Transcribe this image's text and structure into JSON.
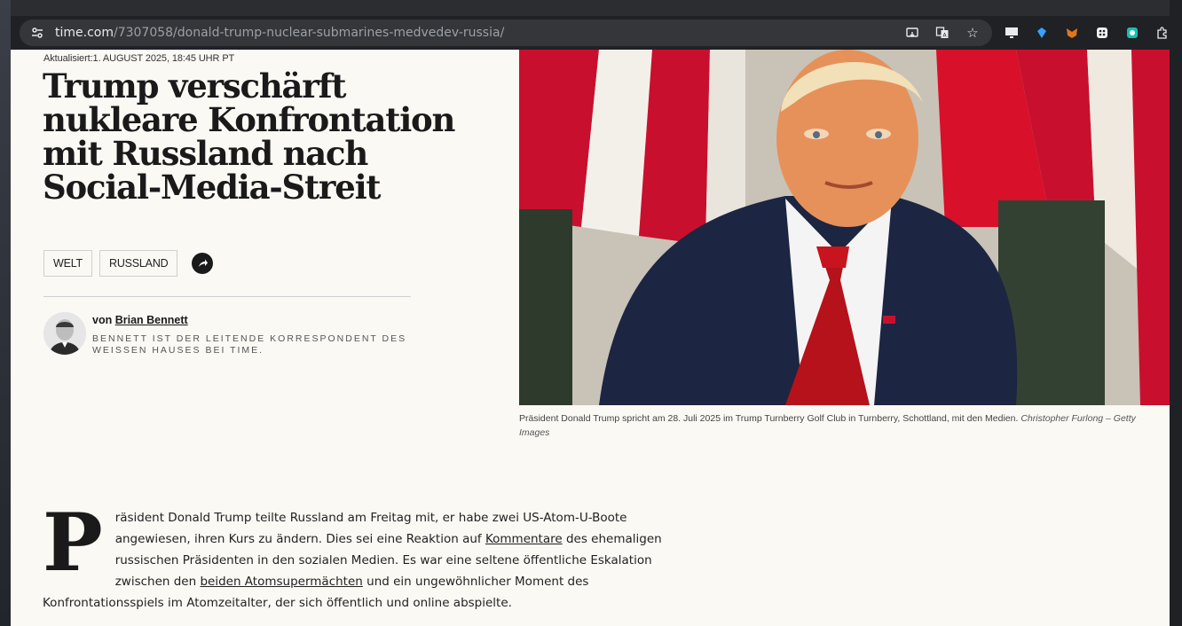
{
  "browser": {
    "url_domain": "time.com",
    "url_path": "/7307058/donald-trump-nuclear-submarines-medvedev-russia/"
  },
  "article": {
    "updated": "Aktualisiert:1. AUGUST 2025, 18:45 UHR PT",
    "headline": "Trump verschärft nukleare Konfrontation mit Russland nach Social-Media-Streit",
    "tags": [
      "WELT",
      "RUSSLAND"
    ],
    "author": {
      "by": "von",
      "name": "Brian Bennett",
      "bio": "Bennett ist der leitende Korrespondent des Weissen Hauses bei TIME."
    },
    "caption": {
      "text": "Präsident Donald Trump spricht am 28. Juli 2025 im Trump Turnberry Golf Club in Turnberry, Schottland, mit den Medien.",
      "credit": "Christopher Furlong – Getty Images"
    },
    "body": {
      "dropcap": "P",
      "part1": "räsident Donald Trump teilte Russland am Freitag mit, er habe zwei US-Atom-U-Boote angewiesen, ihren Kurs zu ändern. Dies sei eine Reaktion auf ",
      "link1": "Kommentare",
      "part2": " des ehemaligen russischen Präsidenten in den sozialen Medien. Es war eine seltene öffentliche Eskalation zwischen den ",
      "link2": "beiden Atomsupermächten",
      "part3": " und ein ungewöhnlicher Moment des Konfrontationsspiels im Atomzeitalter, der sich öffentlich und online abspielte."
    }
  },
  "icons": {
    "site_info": "tune-icon",
    "cast": "cast-icon",
    "translate": "translate-icon",
    "bookmark": "star-icon",
    "share": "share-arrow-icon"
  }
}
